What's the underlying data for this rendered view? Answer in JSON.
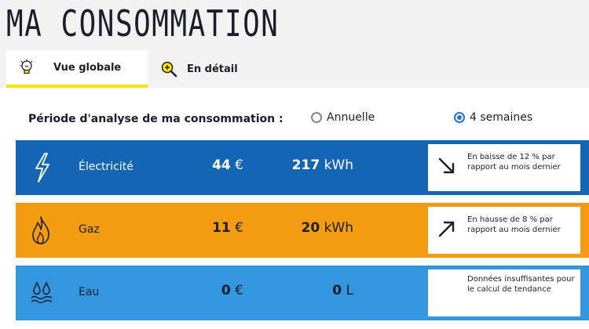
{
  "page": {
    "title": "MA CONSOMMATION"
  },
  "tabs": [
    {
      "label": "Vue globale",
      "icon": "lightbulb-icon",
      "active": true
    },
    {
      "label": "En détail",
      "icon": "magnifier-icon",
      "active": false
    }
  ],
  "period": {
    "label": "Période d'analyse de ma consommation :",
    "options": [
      {
        "label": "Annuelle",
        "selected": false
      },
      {
        "label": "4 semaines",
        "selected": true
      }
    ]
  },
  "rows": [
    {
      "name": "Électricité",
      "icon": "lightning-icon",
      "color": "#1565b5",
      "amount": "44",
      "currency": "€",
      "quantity": "217",
      "unit": "kWh",
      "trend": "down",
      "message": "En baisse de 12 % par rapport au mois dernier"
    },
    {
      "name": "Gaz",
      "icon": "flame-icon",
      "color": "#f39c12",
      "amount": "11",
      "currency": "€",
      "quantity": "20",
      "unit": "kWh",
      "trend": "up",
      "message": "En hausse de 8 % par rapport au mois dernier"
    },
    {
      "name": "Eau",
      "icon": "water-drops-icon",
      "color": "#3496dc",
      "amount": "0",
      "currency": "€",
      "quantity": "0",
      "unit": "L",
      "trend": "none",
      "message": "Données insuffisantes pour le calcul de tendance"
    }
  ]
}
